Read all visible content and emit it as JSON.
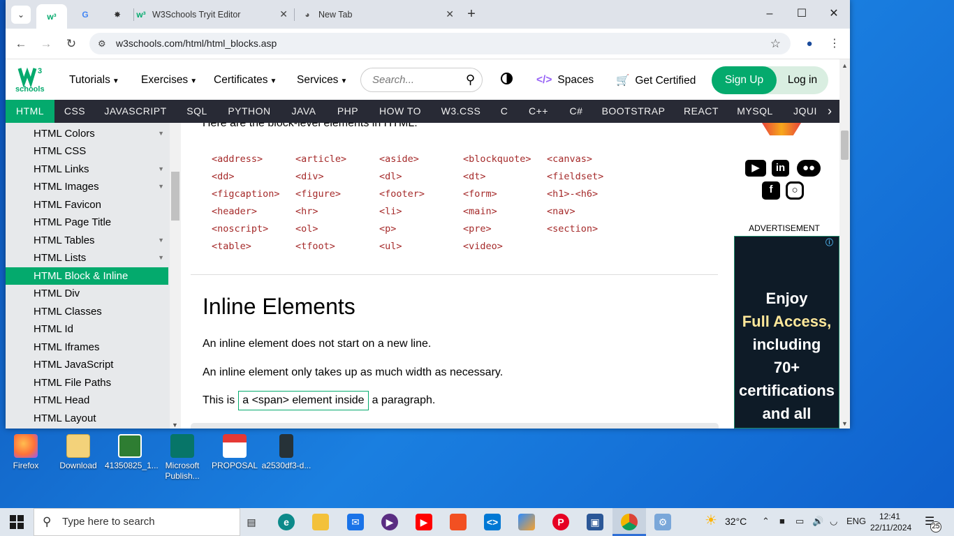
{
  "browser": {
    "tabs": [
      {
        "title": "",
        "icon": "w3schools-icon"
      },
      {
        "title": "",
        "icon": "google-icon"
      },
      {
        "title": "",
        "icon": "openai-icon"
      },
      {
        "title": "W3Schools Tryit Editor",
        "icon": "w3schools-icon"
      },
      {
        "title": "New Tab",
        "icon": "chrome-icon"
      }
    ],
    "url": "w3schools.com/html/html_blocks.asp"
  },
  "site": {
    "logo_text": "schools",
    "nav": {
      "tutorials": "Tutorials",
      "exercises": "Exercises",
      "certificates": "Certificates",
      "services": "Services",
      "search_placeholder": "Search...",
      "spaces": "Spaces",
      "get_certified": "Get Certified",
      "sign_up": "Sign Up",
      "log_in": "Log in"
    },
    "languages": [
      "HTML",
      "CSS",
      "JAVASCRIPT",
      "SQL",
      "PYTHON",
      "JAVA",
      "PHP",
      "HOW TO",
      "W3.CSS",
      "C",
      "C++",
      "C#",
      "BOOTSTRAP",
      "REACT",
      "MYSQL",
      "JQUI"
    ],
    "active_language": "HTML",
    "sidebar": [
      "HTML Colors",
      "HTML CSS",
      "HTML Links",
      "HTML Images",
      "HTML Favicon",
      "HTML Page Title",
      "HTML Tables",
      "HTML Lists",
      "HTML Block & Inline",
      "HTML Div",
      "HTML Classes",
      "HTML Id",
      "HTML Iframes",
      "HTML JavaScript",
      "HTML File Paths",
      "HTML Head",
      "HTML Layout"
    ],
    "active_sidebar": "HTML Block & Inline"
  },
  "content": {
    "intro": "Here are the block-level elements in HTML:",
    "block_elements": [
      [
        "<address>",
        "<article>",
        "<aside>",
        "<blockquote>",
        "<canvas>"
      ],
      [
        "<dd>",
        "<div>",
        "<dl>",
        "<dt>",
        "<fieldset>"
      ],
      [
        "<figcaption>",
        "<figure>",
        "<footer>",
        "<form>",
        "<h1>-<h6>"
      ],
      [
        "<header>",
        "<hr>",
        "<li>",
        "<main>",
        "<nav>"
      ],
      [
        "<noscript>",
        "<ol>",
        "<p>",
        "<pre>",
        "<section>"
      ],
      [
        "<table>",
        "<tfoot>",
        "<ul>",
        "<video>",
        ""
      ]
    ],
    "heading": "Inline Elements",
    "para1": "An inline element does not start on a new line.",
    "para2": "An inline element only takes up as much width as necessary.",
    "para3_before": "This is",
    "para3_span": "a <span> element inside",
    "para3_after": "a paragraph."
  },
  "right_panel": {
    "advertisement_label": "ADVERTISEMENT",
    "ad_line1": "Enjoy",
    "ad_highlight": "Full Access,",
    "ad_line3": "including",
    "ad_line4": "70+",
    "ad_line5": "certifications",
    "ad_line6": "and all"
  },
  "desktop": {
    "icons": [
      {
        "label": "Firefox",
        "icon": "firefox-icon",
        "color": "#ff7139"
      },
      {
        "label": "Download",
        "icon": "folder-icon",
        "color": "#f3d27a"
      },
      {
        "label": "41350825_1...",
        "icon": "image-file-icon",
        "color": "#2e7d32"
      },
      {
        "label": "Microsoft Publish...",
        "icon": "publisher-icon",
        "color": "#077568"
      },
      {
        "label": "PROPOSAL",
        "icon": "pdf-icon",
        "color": "#e53935"
      },
      {
        "label": "a2530df3-d...",
        "icon": "phone-image-icon",
        "color": "#263238"
      }
    ]
  },
  "taskbar": {
    "search_placeholder": "Type here to search",
    "weather": "32°C",
    "language": "ENG",
    "time": "12:41",
    "date": "22/11/2024",
    "notification_count": "25"
  }
}
